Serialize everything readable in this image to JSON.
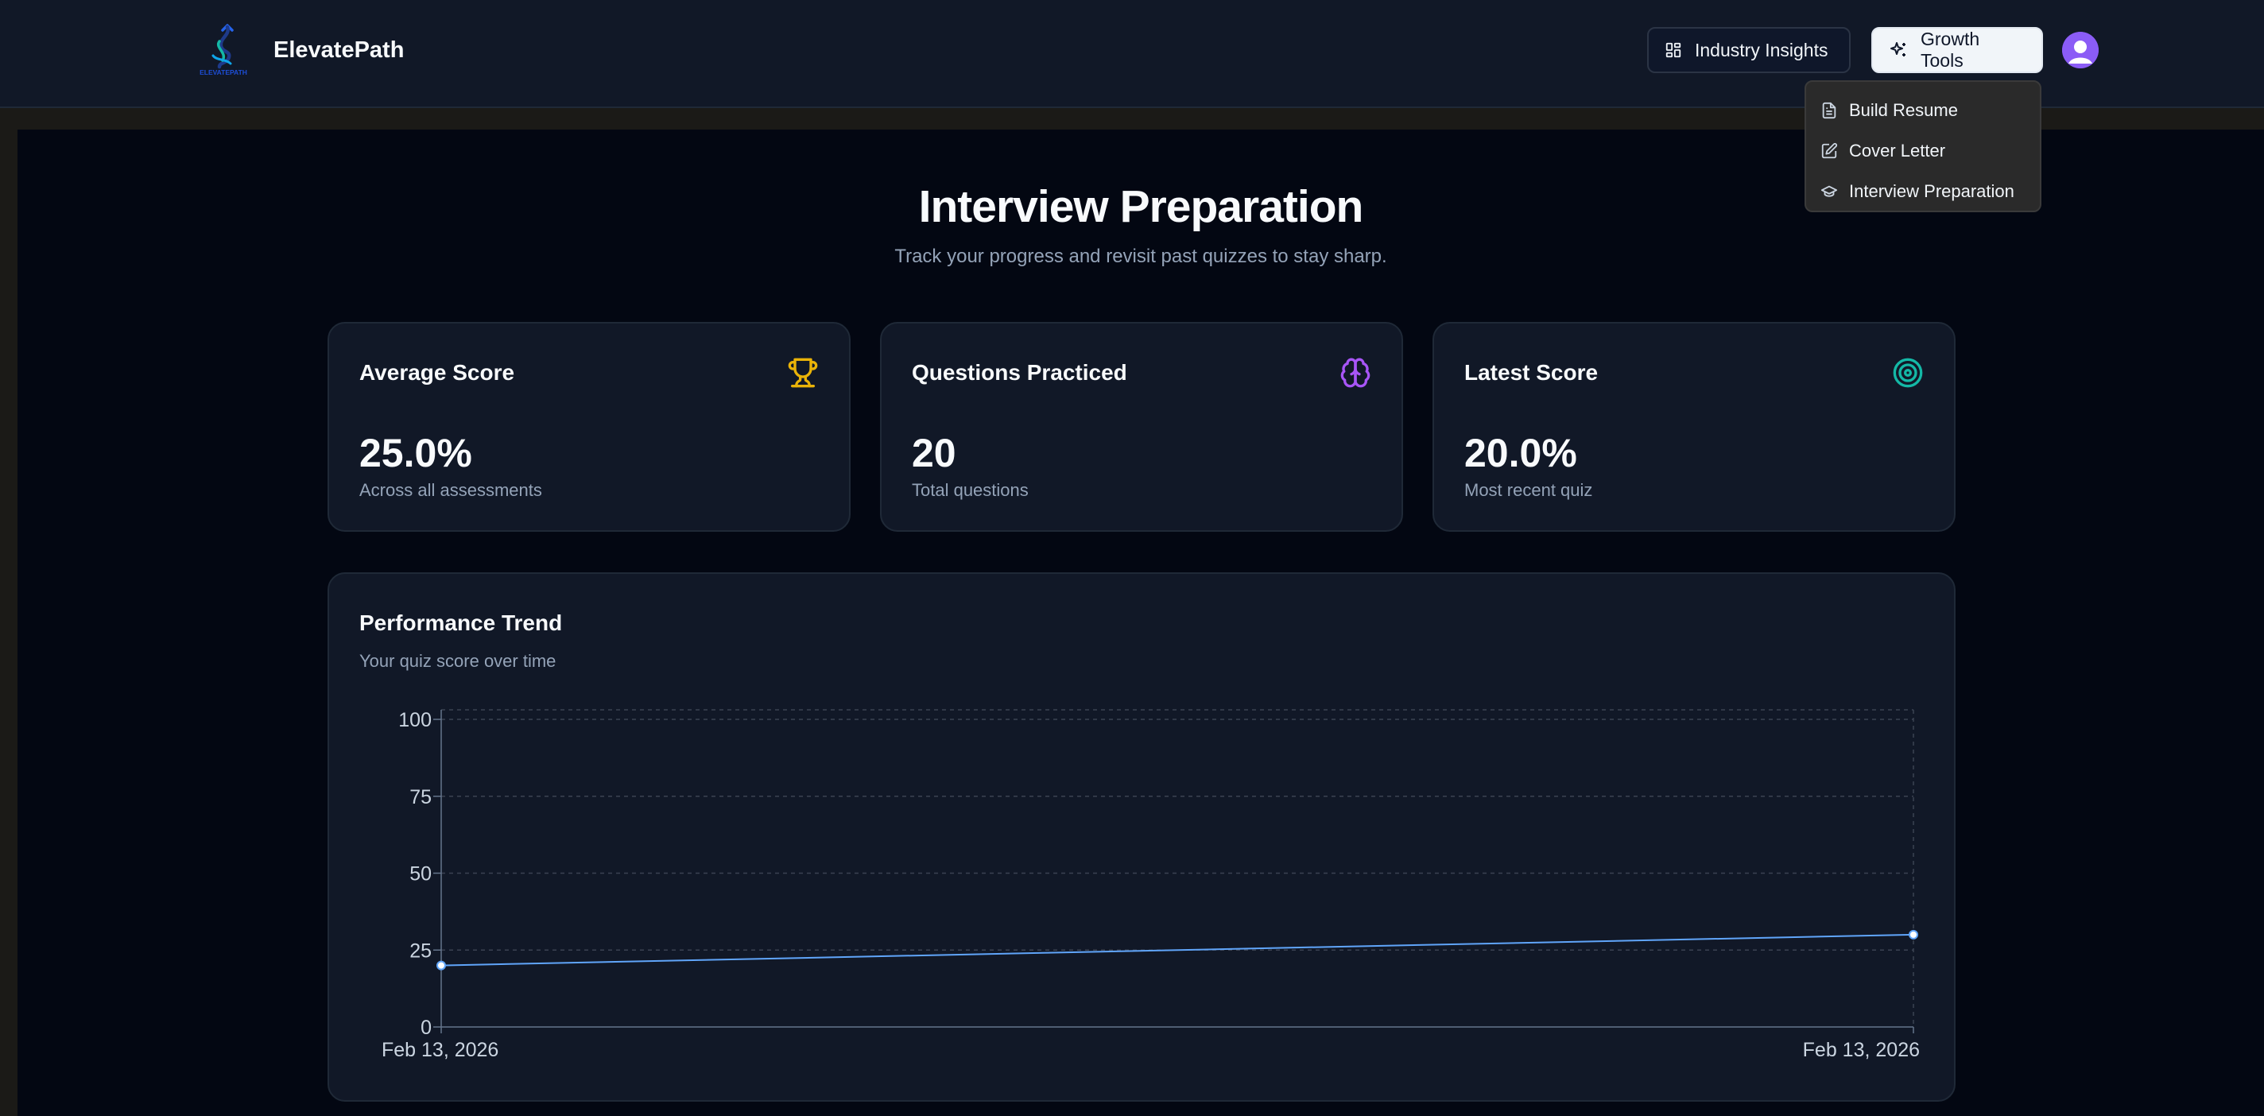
{
  "header": {
    "brand_name": "ElevatePath",
    "logo_text": "ELEVATEPATH",
    "nav": {
      "industry_insights": "Industry Insights",
      "growth_tools": "Growth Tools"
    },
    "icons": {
      "insights": "layout-dashboard-icon",
      "growth": "sparkles-icon",
      "avatar": "user-avatar-icon"
    }
  },
  "dropdown": {
    "items": [
      {
        "label": "Build Resume",
        "icon": "file-text-icon"
      },
      {
        "label": "Cover Letter",
        "icon": "pen-square-icon"
      },
      {
        "label": "Interview Preparation",
        "icon": "graduation-cap-icon"
      }
    ]
  },
  "page": {
    "title": "Interview Preparation",
    "subtitle": "Track your progress and revisit past quizzes to stay sharp."
  },
  "stats": [
    {
      "title": "Average Score",
      "value": "25.0%",
      "caption": "Across all assessments",
      "icon": "trophy-icon",
      "color": "#eab308"
    },
    {
      "title": "Questions Practiced",
      "value": "20",
      "caption": "Total questions",
      "icon": "brain-icon",
      "color": "#a855f7"
    },
    {
      "title": "Latest Score",
      "value": "20.0%",
      "caption": "Most recent quiz",
      "icon": "target-icon",
      "color": "#14b8a6"
    }
  ],
  "performance": {
    "title": "Performance Trend",
    "subtitle": "Your quiz score over time"
  },
  "chart_data": {
    "type": "line",
    "x": [
      "Feb 13, 2026",
      "Feb 13, 2026"
    ],
    "series": [
      {
        "values": [
          20,
          30
        ],
        "color": "#60a5fa"
      }
    ],
    "yticks": [
      0,
      25,
      50,
      75,
      100
    ],
    "ylim": [
      0,
      100
    ],
    "grid": true
  },
  "colors": {
    "background": "#030712",
    "card": "#111827",
    "accent_line": "#60a5fa",
    "avatar": "#8b5cf6"
  }
}
